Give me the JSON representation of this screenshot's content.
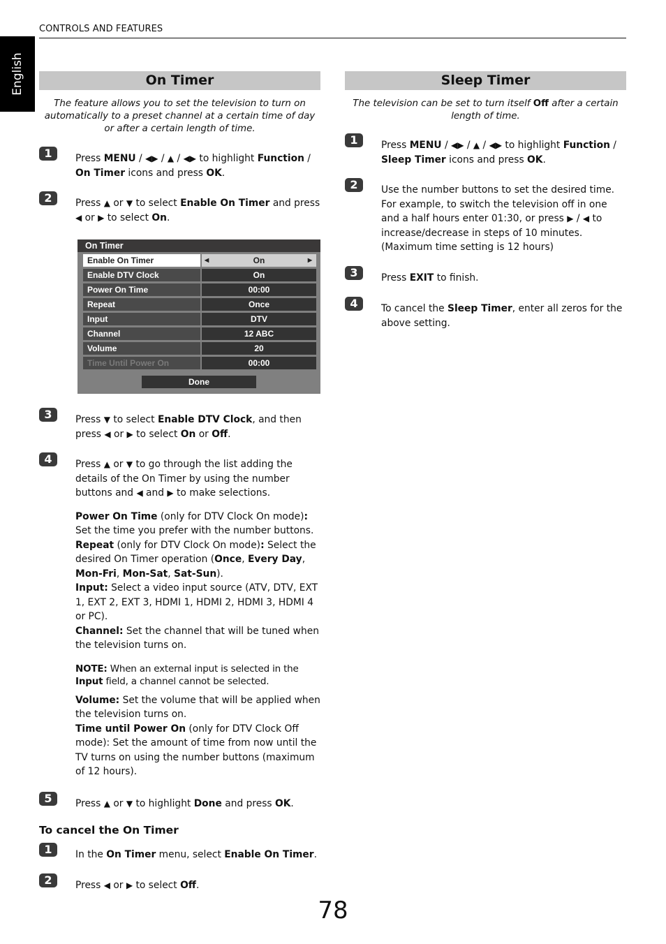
{
  "header": {
    "running_head": "CONTROLS AND FEATURES",
    "language_tab": "English"
  },
  "on_timer": {
    "title": "On Timer",
    "intro": "The feature allows you to set the television to turn on automatically to a preset channel at a certain time of day or after a certain length of time.",
    "steps": [
      {
        "number": "1",
        "parts": [
          "Press ",
          "MENU",
          " / ",
          "◀▶",
          " / ",
          "▲",
          " / ",
          "◀▶",
          " to highlight ",
          "Function",
          " / ",
          "On Timer",
          " icons and press ",
          "OK",
          "."
        ]
      },
      {
        "number": "2",
        "parts": [
          "Press ",
          "▲",
          " or ",
          "▼",
          " to select ",
          "Enable On Timer",
          " and press ",
          "◀",
          " or ",
          "▶",
          " to select ",
          "On",
          "."
        ]
      },
      {
        "number": "3",
        "parts": [
          "Press ",
          "▼",
          " to select ",
          "Enable DTV Clock",
          ", and then press ",
          "◀",
          " or ",
          "▶",
          " to select ",
          "On",
          " or ",
          "Off",
          "."
        ]
      },
      {
        "number": "4",
        "parts": [
          "Press ",
          "▲",
          " or ",
          "▼",
          " to go through the list adding the details of the On Timer by using the number buttons and ",
          "◀",
          " and ",
          "▶",
          " to make selections."
        ]
      },
      {
        "number": "5",
        "parts": [
          "Press ",
          "▲",
          " or ",
          "▼",
          " to highlight ",
          "Done",
          " and press ",
          "OK",
          "."
        ]
      }
    ],
    "osd": {
      "title": "On Timer",
      "rows": [
        {
          "label": "Enable On Timer",
          "value": "On",
          "selected": true
        },
        {
          "label": "Enable DTV Clock",
          "value": "On"
        },
        {
          "label": "Power On Time",
          "value": "00:00"
        },
        {
          "label": "Repeat",
          "value": "Once"
        },
        {
          "label": "Input",
          "value": "DTV"
        },
        {
          "label": "Channel",
          "value": "12 ABC"
        },
        {
          "label": "Volume",
          "value": "20"
        },
        {
          "label": "Time Until Power On",
          "value": "00:00",
          "disabled": true
        }
      ],
      "done_label": "Done",
      "arrow_left": "◀",
      "arrow_right": "▶"
    },
    "details": {
      "power_on_time": [
        "Power On Time",
        " (only for DTV Clock On mode)",
        ":",
        " Set the time you prefer with the number buttons."
      ],
      "repeat": [
        "Repeat",
        " (only for DTV Clock On mode)",
        ":",
        " Select the desired On Timer operation (",
        "Once",
        ", ",
        "Every Day",
        ", ",
        "Mon-Fri",
        ", ",
        "Mon-Sat",
        ", ",
        "Sat-Sun",
        ")."
      ],
      "input": [
        "Input:",
        " Select a video input source (ATV, DTV, EXT 1, EXT 2, EXT 3, HDMI 1, HDMI 2, HDMI 3, HDMI 4 or PC)."
      ],
      "channel": [
        "Channel:",
        " Set the channel that will be tuned when the television turns on."
      ],
      "note": [
        "NOTE:",
        " When an external input is selected in the ",
        "Input",
        " field, a channel cannot be selected."
      ],
      "volume": [
        "Volume:",
        " Set the volume that will be applied when the television turns on."
      ],
      "time_until": [
        "Time until Power On",
        " (only for DTV Clock Off mode): Set the amount of time from now until the TV turns on using the number buttons (maximum of 12 hours)."
      ]
    },
    "cancel": {
      "heading": "To cancel the On Timer",
      "steps": [
        {
          "number": "1",
          "parts": [
            "In the ",
            "On Timer",
            " menu, select ",
            "Enable On Timer",
            "."
          ]
        },
        {
          "number": "2",
          "parts": [
            "Press ",
            "◀",
            " or ",
            "▶",
            " to select ",
            "Off",
            "."
          ]
        }
      ]
    }
  },
  "sleep_timer": {
    "title": "Sleep Timer",
    "intro": [
      "The television can be set to turn itself ",
      "Off",
      " after a certain length of time."
    ],
    "steps": [
      {
        "number": "1",
        "parts": [
          "Press ",
          "MENU",
          " / ",
          "◀▶",
          " / ",
          "▲",
          " / ",
          "◀▶",
          " to highlight ",
          "Function",
          " / ",
          "Sleep Timer",
          " icons and press ",
          "OK",
          "."
        ]
      },
      {
        "number": "2",
        "parts": [
          "Use the number buttons to set the desired time. For example, to switch the television off in one and a half hours enter 01:30, or press ",
          "▶",
          " / ",
          "◀",
          " to increase/decrease in steps of 10 minutes. (Maximum time setting is 12 hours)"
        ]
      },
      {
        "number": "3",
        "parts": [
          "Press ",
          "EXIT",
          " to finish."
        ]
      },
      {
        "number": "4",
        "parts": [
          "To cancel the ",
          "Sleep Timer",
          ", enter all zeros for the above setting."
        ]
      }
    ]
  },
  "page_number": "78"
}
